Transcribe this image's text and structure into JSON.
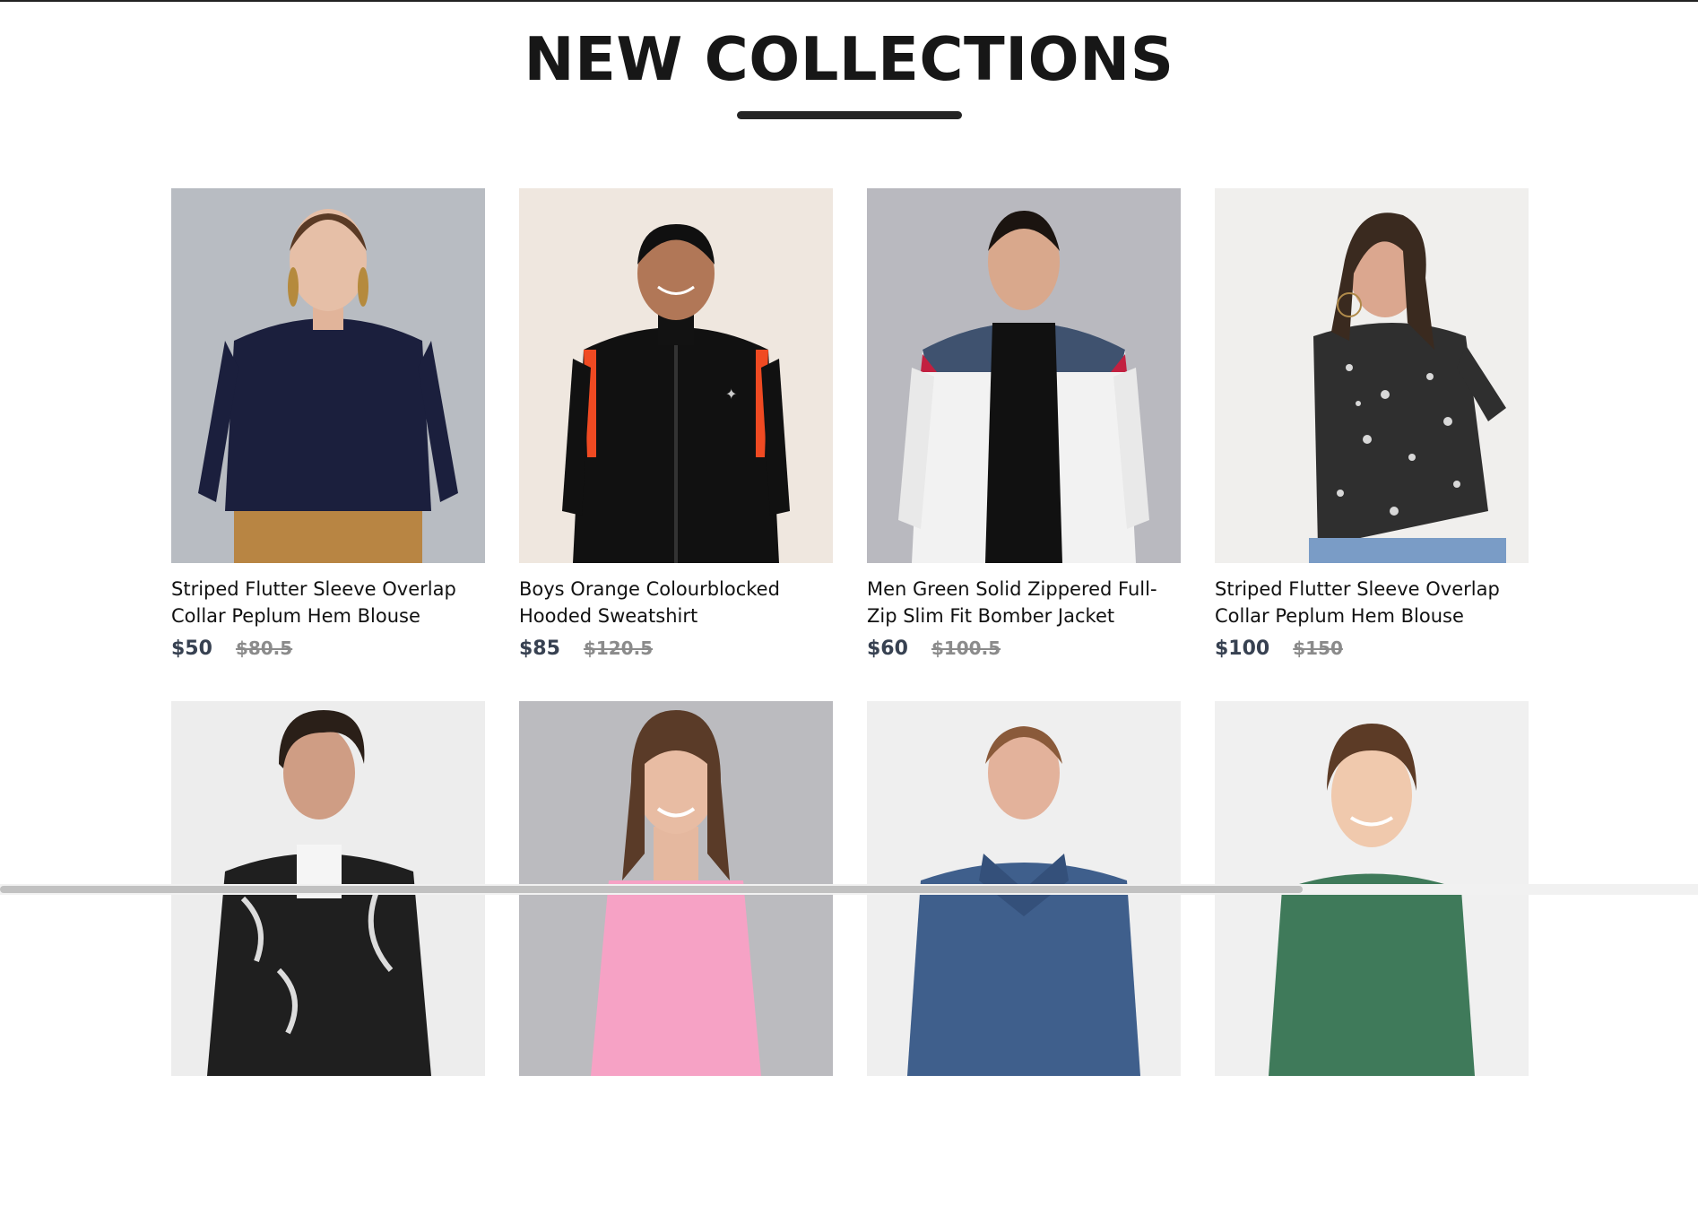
{
  "section": {
    "title": "NEW COLLECTIONS"
  },
  "products": [
    {
      "name": "Striped Flutter Sleeve Overlap Collar Peplum Hem Blouse",
      "new_price": "$50",
      "old_price": "$80.5",
      "bg_color": "#b8bcc2",
      "icon": "woman-navy-sweater-photo"
    },
    {
      "name": "Boys Orange Colourblocked Hooded Sweatshirt",
      "new_price": "$85",
      "old_price": "$120.5",
      "bg_color": "#efe7df",
      "icon": "boy-black-track-jacket-photo"
    },
    {
      "name": "Men Green Solid Zippered Full-Zip Slim Fit Bomber Jacket",
      "new_price": "$60",
      "old_price": "$100.5",
      "bg_color": "#b9b9bf",
      "icon": "man-puffer-jacket-photo"
    },
    {
      "name": "Striped Flutter Sleeve Overlap Collar Peplum Hem Blouse",
      "new_price": "$100",
      "old_price": "$150",
      "bg_color": "#f0efed",
      "icon": "woman-floral-blouse-photo"
    },
    {
      "name": "",
      "new_price": "",
      "old_price": "",
      "bg_color": "#ededed",
      "icon": "man-printed-jacket-photo"
    },
    {
      "name": "",
      "new_price": "",
      "old_price": "",
      "bg_color": "#bbbbbf",
      "icon": "woman-pink-top-photo"
    },
    {
      "name": "",
      "new_price": "",
      "old_price": "",
      "bg_color": "#efefef",
      "icon": "man-denim-jacket-photo"
    },
    {
      "name": "",
      "new_price": "",
      "old_price": "",
      "bg_color": "#f0f0f0",
      "icon": "boy-green-tshirt-photo"
    }
  ]
}
